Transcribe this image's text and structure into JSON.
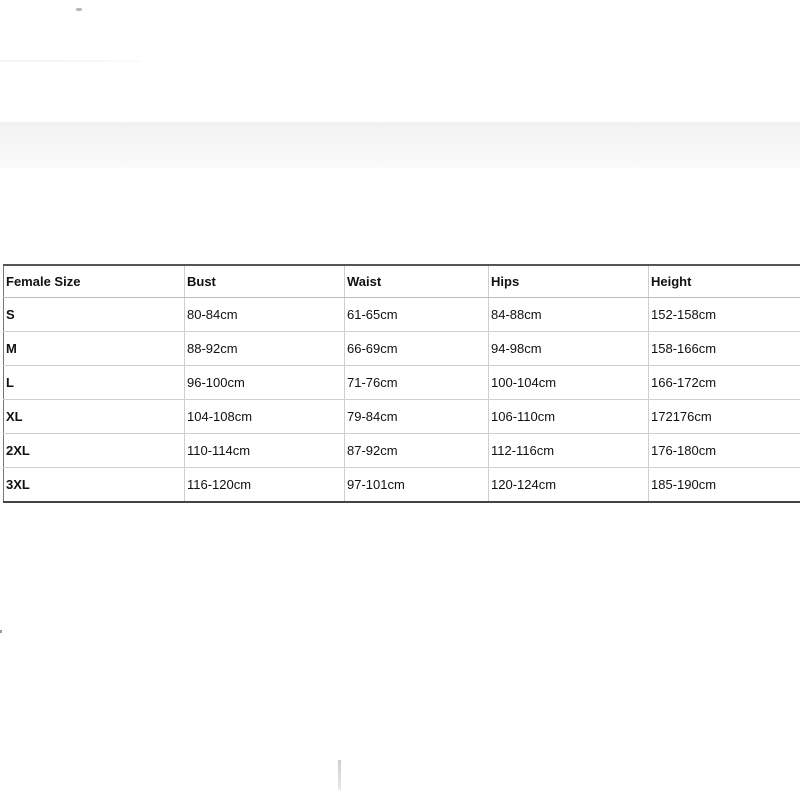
{
  "table": {
    "headers": [
      "Female Size",
      "Bust",
      "Waist",
      "Hips",
      "Height"
    ],
    "rows": [
      [
        "S",
        "80-84cm",
        "61-65cm",
        "84-88cm",
        "152-158cm"
      ],
      [
        "M",
        "88-92cm",
        "66-69cm",
        "94-98cm",
        "158-166cm"
      ],
      [
        "L",
        "96-100cm",
        "71-76cm",
        "100-104cm",
        "166-172cm"
      ],
      [
        "XL",
        "104-108cm",
        "79-84cm",
        "106-110cm",
        "172176cm"
      ],
      [
        "2XL",
        "110-114cm",
        "87-92cm",
        "112-116cm",
        "176-180cm"
      ],
      [
        "3XL",
        "116-120cm",
        "97-101cm",
        "120-124cm",
        "185-190cm"
      ]
    ]
  }
}
